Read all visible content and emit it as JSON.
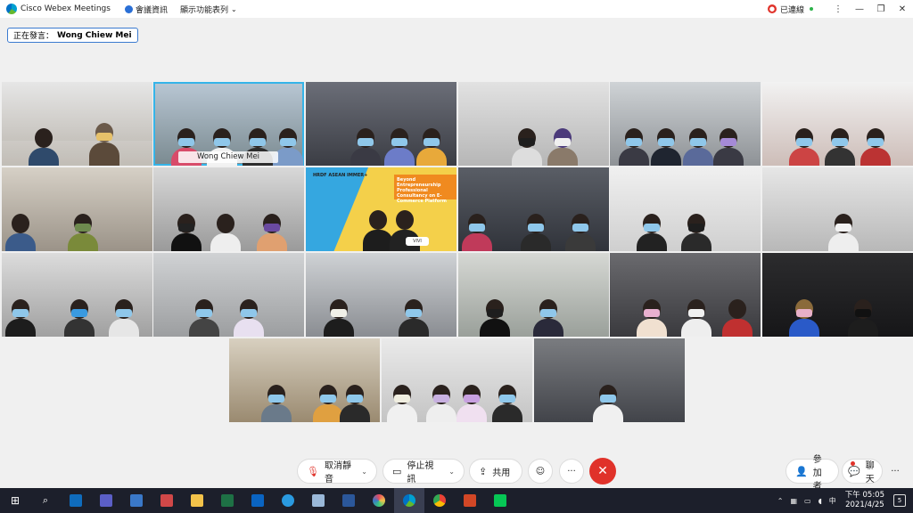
{
  "window": {
    "app_title": "Cisco Webex Meetings",
    "menu_meeting_info": "會議資訊",
    "menu_layout": "顯示功能表列",
    "status": "已連線"
  },
  "speaker": {
    "prefix": "正在發言：",
    "name": "Wong Chiew Mei"
  },
  "grid": {
    "active_tile_name": "Wong Chiew Mei",
    "banner_logos": "HRDF  ASEAN  IMMER+",
    "banner_title": "Beyond Entrepreneurship Professional Consultancy on E-Commerce Platform",
    "banner_presenter": "VIVI"
  },
  "controls": {
    "mute": "取消靜音",
    "video": "停止視訊",
    "share": "共用",
    "participants": "參加者",
    "chat": "聊天"
  },
  "taskbar": {
    "time": "下午 05:05",
    "date": "2021/4/25",
    "notification_count": "5"
  },
  "colors": {
    "accent": "#35b4e8",
    "end_call": "#e0322a",
    "taskbar": "#1c1f2b"
  }
}
